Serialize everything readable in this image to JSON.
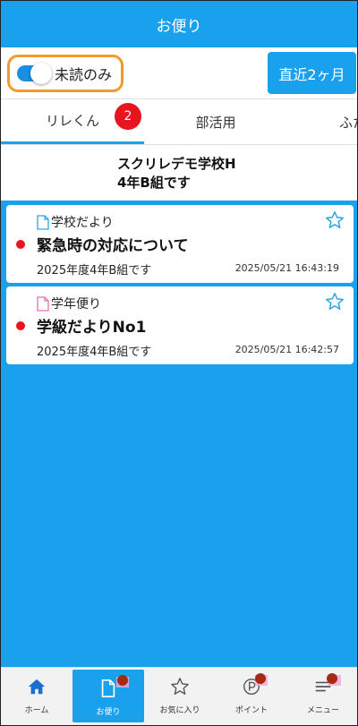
{
  "header": {
    "title": "お便り"
  },
  "controls": {
    "unread_only_label": "未読のみ",
    "unread_only_on": true,
    "period_button_label": "直近2ヶ月"
  },
  "tabs": [
    {
      "label": "リレくん",
      "active": true,
      "badge": "2"
    },
    {
      "label": "部活用",
      "active": false
    },
    {
      "label": "ふた",
      "active": false
    }
  ],
  "school": {
    "line1": "スクリレデモ学校H",
    "line2": "4年B組です"
  },
  "notices": [
    {
      "category": "学校だより",
      "icon": "document-icon",
      "icon_color": "#29a3e8",
      "title": "緊急時の対応について",
      "class_label": "2025年度4年B組です",
      "date": "2025/05/21 16:43:19",
      "unread": true
    },
    {
      "category": "学年便り",
      "icon": "document-icon",
      "icon_color": "#e86fb3",
      "title": "学級だよりNo1",
      "class_label": "2025年度4年B組です",
      "date": "2025/05/21 16:42:57",
      "unread": true
    }
  ],
  "bottom_nav": [
    {
      "label": "ホーム",
      "icon": "home-icon",
      "active": false
    },
    {
      "label": "お便り",
      "icon": "document-icon",
      "active": true
    },
    {
      "label": "お気に入り",
      "icon": "star-icon",
      "active": false
    },
    {
      "label": "ポイント",
      "icon": "point-icon",
      "active": false
    },
    {
      "label": "メニュー",
      "icon": "menu-icon",
      "active": false
    }
  ],
  "colors": {
    "primary": "#1aa1ee",
    "accent_orange": "#f39a2b",
    "badge_red": "#e8141e"
  }
}
